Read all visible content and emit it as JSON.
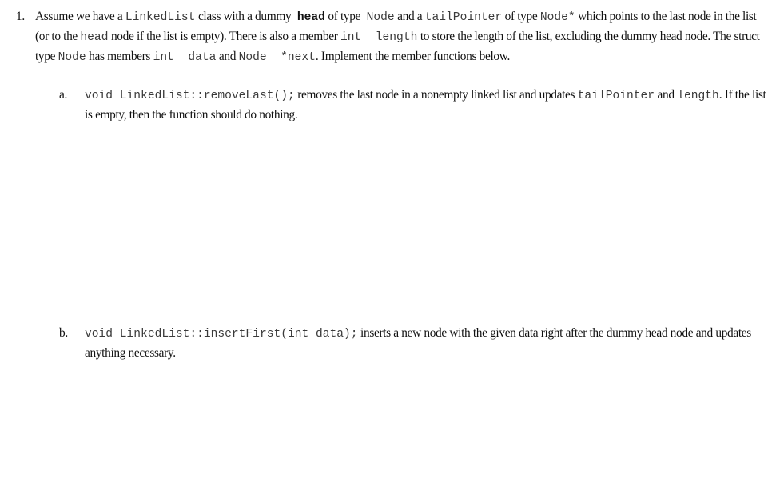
{
  "question": {
    "number": "1.",
    "intro": {
      "t1": "Assume we have a ",
      "c1": "LinkedList",
      "t2": " class with a dummy ",
      "c2": "head",
      "t3": " of type ",
      "c3": "Node",
      "t4": " and a ",
      "c4": "tailPointer",
      "t5": " of type ",
      "c5": "Node*",
      "t6": " which points to the last node in the list (or to the ",
      "c6": "head",
      "t7": " node if the list is empty). There is also a member ",
      "c7": "int  length",
      "t8": " to store the length of the list, excluding the dummy head node. The struct type ",
      "c8": "Node",
      "t9": " has members ",
      "c9": "int  data",
      "t10": " and ",
      "c10": "Node  *next",
      "t11": ". Implement the member functions below."
    },
    "parts": [
      {
        "label": "a.",
        "signature": "void LinkedList::removeLast();",
        "t1": " removes the last node in a nonempty linked list and updates ",
        "c1": "tailPointer",
        "t2": " and ",
        "c2": "length",
        "t3": ". If the list is empty, then the function should do nothing."
      },
      {
        "label": "b.",
        "signature": "void LinkedList::insertFirst(int data);",
        "t1": " inserts a new node with the given data right after the dummy head node and updates anything necessary."
      }
    ]
  }
}
